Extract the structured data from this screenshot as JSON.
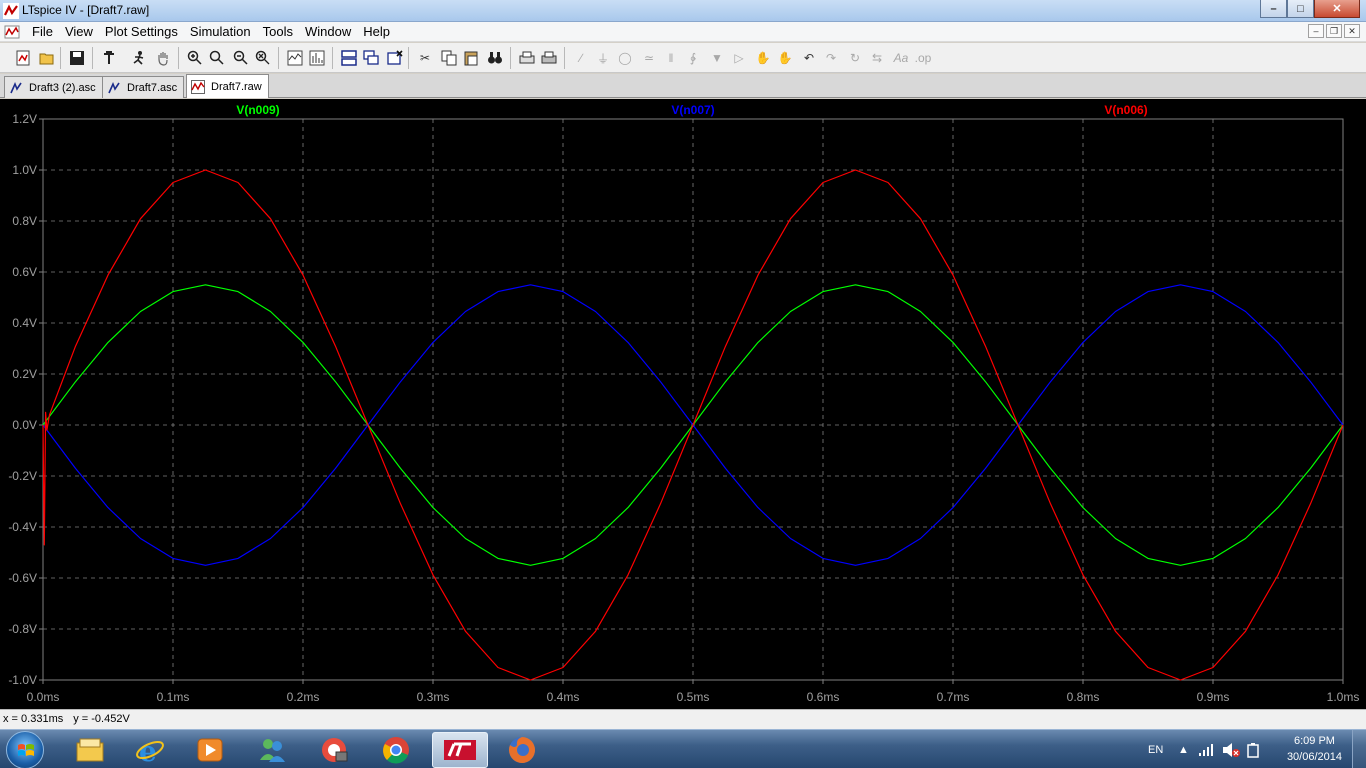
{
  "window": {
    "title": "LTspice IV - [Draft7.raw]",
    "minimize": "–",
    "maximize": "□",
    "close": "✕"
  },
  "menu": {
    "items": [
      "File",
      "View",
      "Plot Settings",
      "Simulation",
      "Tools",
      "Window",
      "Help"
    ],
    "mdi": {
      "minimize": "–",
      "restore": "❐",
      "close": "✕"
    }
  },
  "toolbar": {
    "icons": [
      "new-schematic-icon",
      "open-icon",
      "save-icon",
      "control-panel-icon",
      "run-icon",
      "pan-icon",
      "zoom-in-icon",
      "zoom-full-icon",
      "zoom-out-icon",
      "zoom-cancel-icon",
      "autorange-icon",
      "fft-icon",
      "tile-horizontal-icon",
      "cascade-icon",
      "close-window-icon",
      "cut-icon",
      "copy-icon",
      "paste-icon",
      "find-icon",
      "print-preview-icon",
      "print-icon",
      "wire-icon",
      "ground-icon",
      "label-net-icon",
      "resistor-icon",
      "capacitor-icon",
      "inductor-icon",
      "diode-icon",
      "component-icon",
      "move-icon",
      "drag-icon",
      "undo-icon",
      "redo-icon",
      "rotate-icon",
      "mirror-icon",
      "text-icon",
      "spice-directive-icon"
    ]
  },
  "tabs": [
    {
      "label": "Draft3 (2).asc",
      "active": false
    },
    {
      "label": "Draft7.asc",
      "active": false
    },
    {
      "label": "Draft7.raw",
      "active": true
    }
  ],
  "chart_data": {
    "type": "line",
    "background": "#000000",
    "grid": true,
    "xlim": [
      0,
      1.0
    ],
    "ylim": [
      -1.0,
      1.2
    ],
    "x_ticks": [
      "0.0ms",
      "0.1ms",
      "0.2ms",
      "0.3ms",
      "0.4ms",
      "0.5ms",
      "0.6ms",
      "0.7ms",
      "0.8ms",
      "0.9ms",
      "1.0ms"
    ],
    "x_tick_values": [
      0,
      0.1,
      0.2,
      0.3,
      0.4,
      0.5,
      0.6,
      0.7,
      0.8,
      0.9,
      1.0
    ],
    "y_ticks": [
      "1.2V",
      "1.0V",
      "0.8V",
      "0.6V",
      "0.4V",
      "0.2V",
      "0.0V",
      "-0.2V",
      "-0.4V",
      "-0.6V",
      "-0.8V",
      "-1.0V"
    ],
    "y_tick_values": [
      1.2,
      1.0,
      0.8,
      0.6,
      0.4,
      0.2,
      0.0,
      -0.2,
      -0.4,
      -0.6,
      -0.8,
      -1.0
    ],
    "x_unit": "ms",
    "series": [
      {
        "name": "V(n009)",
        "color": "#00ff00",
        "x": [
          0,
          0.025,
          0.05,
          0.075,
          0.1,
          0.125,
          0.15,
          0.175,
          0.2,
          0.225,
          0.25,
          0.275,
          0.3,
          0.325,
          0.35,
          0.375,
          0.4,
          0.425,
          0.45,
          0.475,
          0.5,
          0.525,
          0.55,
          0.575,
          0.6,
          0.625,
          0.65,
          0.675,
          0.7,
          0.725,
          0.75,
          0.775,
          0.8,
          0.825,
          0.85,
          0.875,
          0.9,
          0.925,
          0.95,
          0.975,
          1.0
        ],
        "y": [
          0,
          0.17,
          0.324,
          0.445,
          0.523,
          0.55,
          0.523,
          0.445,
          0.324,
          0.17,
          0,
          -0.17,
          -0.324,
          -0.445,
          -0.523,
          -0.55,
          -0.523,
          -0.445,
          -0.324,
          -0.17,
          0,
          0.17,
          0.324,
          0.445,
          0.523,
          0.55,
          0.523,
          0.445,
          0.324,
          0.17,
          0,
          -0.17,
          -0.324,
          -0.445,
          -0.523,
          -0.55,
          -0.523,
          -0.445,
          -0.324,
          -0.17,
          0
        ]
      },
      {
        "name": "V(n007)",
        "color": "#0000ff",
        "x": [
          0,
          0.025,
          0.05,
          0.075,
          0.1,
          0.125,
          0.15,
          0.175,
          0.2,
          0.225,
          0.25,
          0.275,
          0.3,
          0.325,
          0.35,
          0.375,
          0.4,
          0.425,
          0.45,
          0.475,
          0.5,
          0.525,
          0.55,
          0.575,
          0.6,
          0.625,
          0.65,
          0.675,
          0.7,
          0.725,
          0.75,
          0.775,
          0.8,
          0.825,
          0.85,
          0.875,
          0.9,
          0.925,
          0.95,
          0.975,
          1.0
        ],
        "y": [
          0,
          -0.17,
          -0.324,
          -0.445,
          -0.523,
          -0.55,
          -0.523,
          -0.445,
          -0.324,
          -0.17,
          0,
          0.17,
          0.324,
          0.445,
          0.523,
          0.55,
          0.523,
          0.445,
          0.324,
          0.17,
          0,
          -0.17,
          -0.324,
          -0.445,
          -0.523,
          -0.55,
          -0.523,
          -0.445,
          -0.324,
          -0.17,
          0,
          0.17,
          0.324,
          0.445,
          0.523,
          0.55,
          0.523,
          0.445,
          0.324,
          0.17,
          0
        ]
      },
      {
        "name": "V(n006)",
        "color": "#ff0000",
        "x": [
          0,
          0.001,
          0.002,
          0.003,
          0.005,
          0.025,
          0.05,
          0.075,
          0.1,
          0.125,
          0.15,
          0.175,
          0.2,
          0.225,
          0.25,
          0.275,
          0.3,
          0.325,
          0.35,
          0.375,
          0.4,
          0.425,
          0.45,
          0.475,
          0.5,
          0.525,
          0.55,
          0.575,
          0.6,
          0.625,
          0.65,
          0.675,
          0.7,
          0.725,
          0.75,
          0.775,
          0.8,
          0.825,
          0.85,
          0.875,
          0.9,
          0.925,
          0.95,
          0.975,
          1.0
        ],
        "y": [
          0,
          -0.47,
          0.05,
          -0.02,
          0.04,
          0.309,
          0.588,
          0.809,
          0.951,
          1.0,
          0.951,
          0.809,
          0.588,
          0.309,
          0,
          -0.309,
          -0.588,
          -0.809,
          -0.951,
          -1.0,
          -0.951,
          -0.809,
          -0.588,
          -0.309,
          0,
          0.309,
          0.588,
          0.809,
          0.951,
          1.0,
          0.951,
          0.809,
          0.588,
          0.309,
          0,
          -0.309,
          -0.588,
          -0.809,
          -0.951,
          -1.0,
          -0.951,
          -0.809,
          -0.588,
          -0.309,
          0
        ]
      }
    ]
  },
  "status": {
    "x": "x = 0.331ms",
    "y": "y = -0.452V"
  },
  "taskbar": {
    "apps": [
      "explorer-icon",
      "internet-explorer-icon",
      "media-player-icon",
      "messenger-icon",
      "picasa-icon",
      "chrome-icon",
      "ltspice-icon",
      "firefox-icon"
    ],
    "active_app": "ltspice-icon",
    "language": "EN",
    "time": "6:09 PM",
    "date": "30/06/2014"
  }
}
